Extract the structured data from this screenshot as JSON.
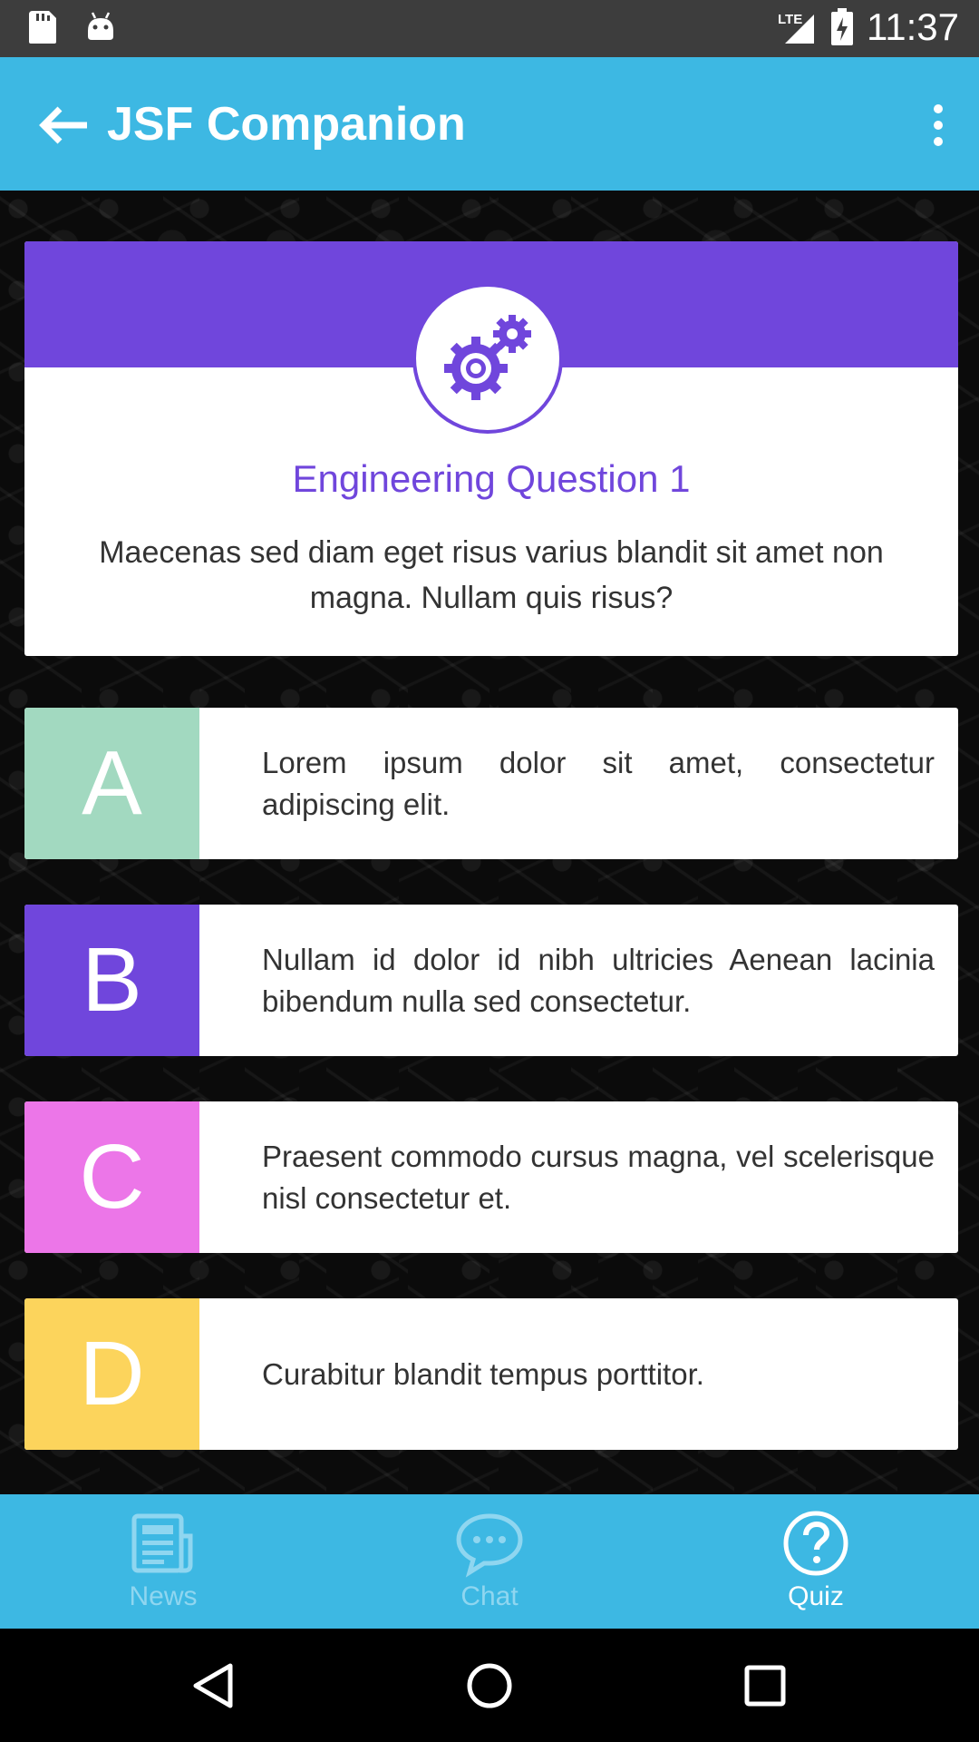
{
  "status_bar": {
    "time": "11:37",
    "network": "LTE",
    "icons": [
      "sd-card-icon",
      "android-icon",
      "signal-icon",
      "battery-icon"
    ]
  },
  "app_bar": {
    "title": "JSF Companion",
    "back_icon": "arrow-left-icon",
    "menu_icon": "more-vert-icon"
  },
  "question": {
    "icon": "gears-icon",
    "title": "Engineering Question 1",
    "text": "Maecenas sed diam eget risus varius blandit sit amet non magna. Nullam quis risus?"
  },
  "answers": [
    {
      "letter": "A",
      "text": "Lorem ipsum dolor sit amet, consectetur adipiscing elit.",
      "color": "#a2d9c0"
    },
    {
      "letter": "B",
      "text": "Nullam id dolor id nibh ultricies Aenean lacinia bibendum nulla sed consectetur.",
      "color": "#7046dc"
    },
    {
      "letter": "C",
      "text": "Praesent commodo cursus magna, vel scelerisque nisl consectetur et.",
      "color": "#ec76e8"
    },
    {
      "letter": "D",
      "text": "Curabitur blandit tempus porttitor.",
      "color": "#fcd45c"
    }
  ],
  "bottom_nav": {
    "items": [
      {
        "label": "News",
        "icon": "newspaper-icon",
        "active": false
      },
      {
        "label": "Chat",
        "icon": "chat-bubble-icon",
        "active": false
      },
      {
        "label": "Quiz",
        "icon": "question-circle-icon",
        "active": true
      }
    ]
  },
  "colors": {
    "primary": "#3db8e3",
    "accent": "#7046dc"
  }
}
